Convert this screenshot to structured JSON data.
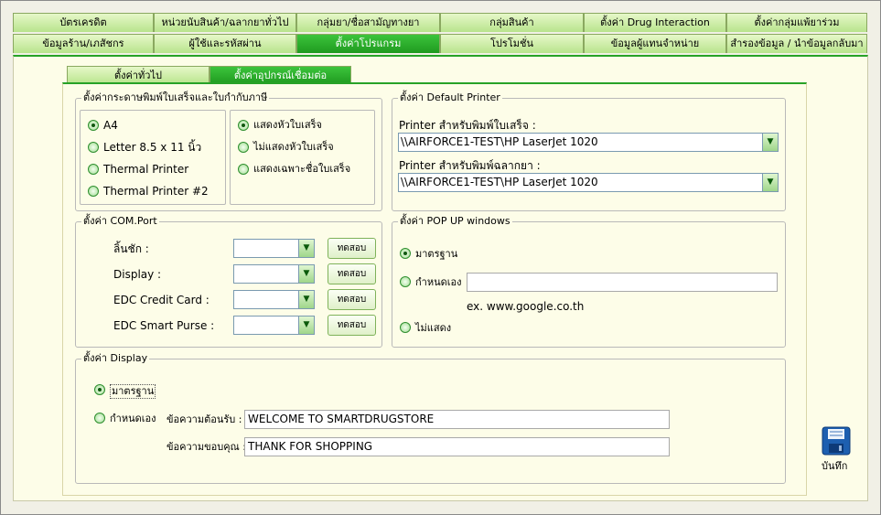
{
  "top_tabs": {
    "row1": [
      "บัตรเครดิต",
      "หน่วยนับสินค้า/ฉลากยาทั่วไป",
      "กลุ่มยา/ชื่อสามัญทางยา",
      "กลุ่มสินค้า",
      "ตั้งค่า Drug Interaction",
      "ตั้งค่ากลุ่มแพ้ยาร่วม"
    ],
    "row2": [
      "ข้อมูลร้าน/เภสัชกร",
      "ผู้ใช้และรหัสผ่าน",
      "ตั้งค่าโปรแกรม",
      "โปรโมชั่น",
      "ข้อมูลผู้แทนจำหน่าย",
      "สำรองข้อมูล / นำข้อมูลกลับมา"
    ]
  },
  "sub_tabs": [
    "ตั้งค่าทั่วไป",
    "ตั้งค่าอุปกรณ์เชื่อมต่อ"
  ],
  "receipt_group": {
    "legend": "ตั้งค่ากระดาษพิมพ์ใบเสร็จและใบกำกับภาษี",
    "paper_options": [
      "A4",
      "Letter 8.5 x 11 นิ้ว",
      "Thermal Printer",
      "Thermal Printer #2"
    ],
    "header_options": [
      "แสดงหัวใบเสร็จ",
      "ไม่แสดงหัวใบเสร็จ",
      "แสดงเฉพาะชื่อใบเสร็จ"
    ]
  },
  "printer_group": {
    "legend": "ตั้งค่า Default Printer",
    "receipt_printer_label": "Printer สำหรับพิมพ์ใบเสร็จ :",
    "receipt_printer_value": "\\\\AIRFORCE1-TEST\\HP LaserJet 1020",
    "label_printer_label": "Printer สำหรับพิมพ์ฉลากยา :",
    "label_printer_value": "\\\\AIRFORCE1-TEST\\HP LaserJet 1020"
  },
  "com_group": {
    "legend": "ตั้งค่า COM.Port",
    "ports": [
      {
        "label": "ลิ้นชัก :",
        "value": "",
        "test": "ทดสอบ"
      },
      {
        "label": "Display :",
        "value": "",
        "test": "ทดสอบ"
      },
      {
        "label": "EDC Credit Card :",
        "value": "",
        "test": "ทดสอบ"
      },
      {
        "label": "EDC Smart Purse :",
        "value": "",
        "test": "ทดสอบ"
      }
    ]
  },
  "popup_group": {
    "legend": "ตั้งค่า POP UP windows",
    "standard": "มาตรฐาน",
    "custom": "กำหนดเอง",
    "custom_value": "",
    "example": "ex.   www.google.co.th",
    "hide": "ไม่แสดง"
  },
  "display_group": {
    "legend": "ตั้งค่า Display",
    "standard": "มาตรฐาน",
    "custom": "กำหนดเอง",
    "welcome_label": "ข้อความต้อนรับ :",
    "welcome_value": "WELCOME TO SMARTDRUGSTORE",
    "thanks_label": "ข้อความขอบคุณ :",
    "thanks_value": "THANK FOR SHOPPING"
  },
  "save_label": "บันทึก",
  "colors": {
    "accent": "#27a227",
    "tab_light": "#c8eea0",
    "background": "#f1f0e6",
    "panel": "#fdfde8"
  }
}
